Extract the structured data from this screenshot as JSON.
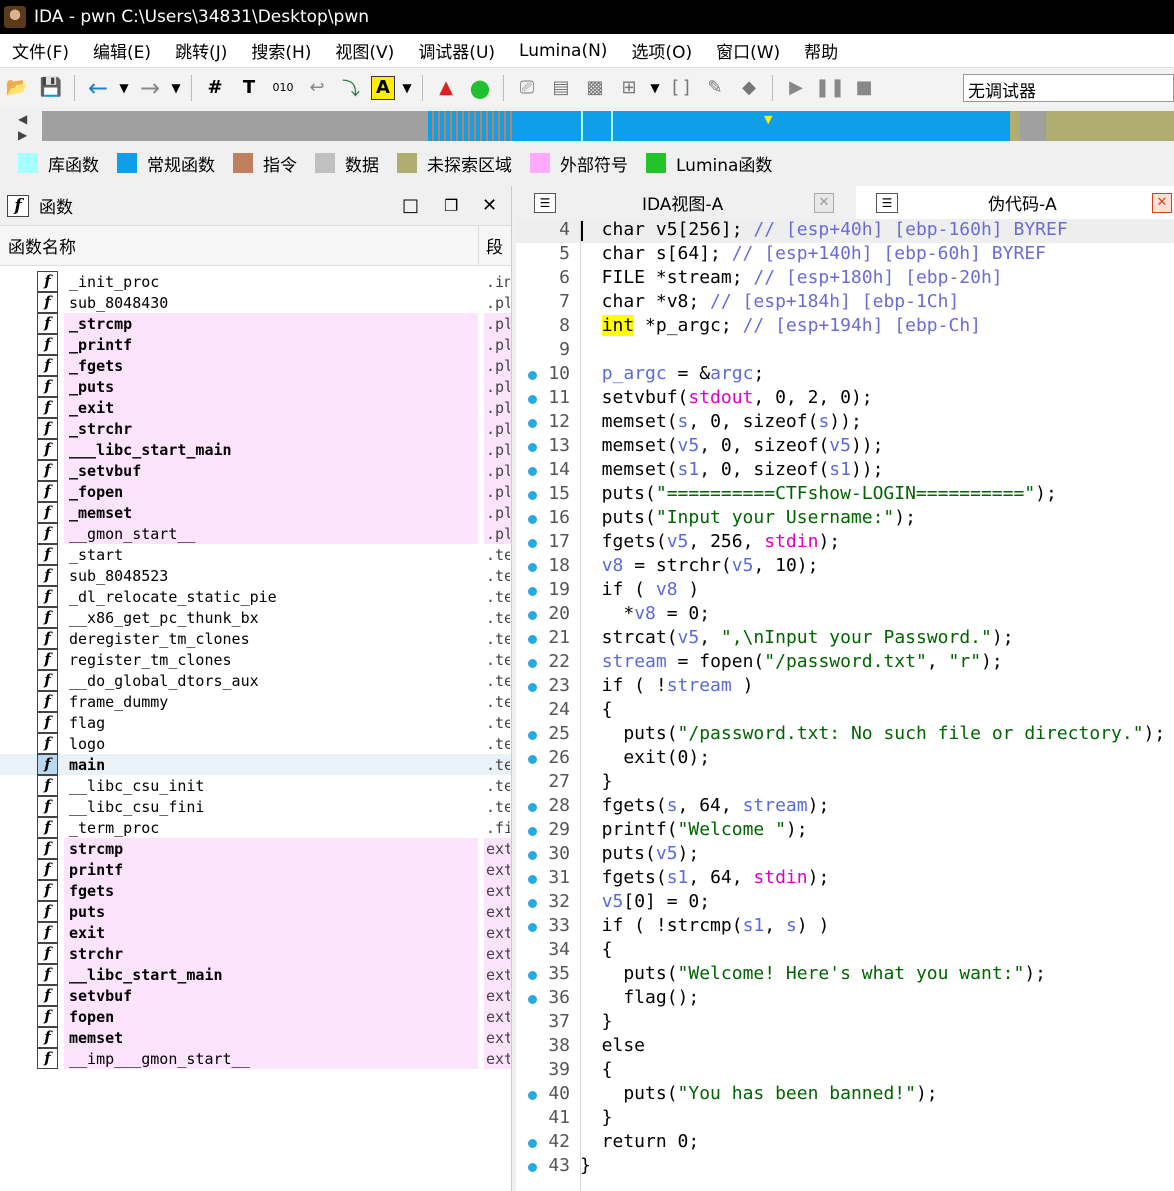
{
  "window": {
    "title": "IDA - pwn C:\\Users\\34831\\Desktop\\pwn"
  },
  "menu": [
    "文件(F)",
    "编辑(E)",
    "跳转(J)",
    "搜索(H)",
    "视图(V)",
    "调试器(U)",
    "Lumina(N)",
    "选项(O)",
    "窗口(W)",
    "帮助"
  ],
  "toolbar": {
    "debugger_label": "无调试器"
  },
  "legend": [
    {
      "label": "库函数",
      "color": "#a8ffff"
    },
    {
      "label": "常规函数",
      "color": "#0f9ee8"
    },
    {
      "label": "指令",
      "color": "#c08060"
    },
    {
      "label": "数据",
      "color": "#c0c0c0"
    },
    {
      "label": "未探索区域",
      "color": "#b0ad70"
    },
    {
      "label": "外部符号",
      "color": "#ffaaff"
    },
    {
      "label": "Lumina函数",
      "color": "#22c42a"
    }
  ],
  "functions_panel": {
    "title": "函数",
    "col_name": "函数名称",
    "col_seg": "段",
    "rows": [
      {
        "name": "_init_proc",
        "seg": ".init",
        "style": "normal"
      },
      {
        "name": "sub_8048430",
        "seg": ".plt",
        "style": "normal"
      },
      {
        "name": "_strcmp",
        "seg": ".plt",
        "style": "pinkbold"
      },
      {
        "name": "_printf",
        "seg": ".plt",
        "style": "pinkbold"
      },
      {
        "name": "_fgets",
        "seg": ".plt",
        "style": "pinkbold"
      },
      {
        "name": "_puts",
        "seg": ".plt",
        "style": "pinkbold"
      },
      {
        "name": "_exit",
        "seg": ".plt",
        "style": "pinkbold"
      },
      {
        "name": "_strchr",
        "seg": ".plt",
        "style": "pinkbold"
      },
      {
        "name": "___libc_start_main",
        "seg": ".plt",
        "style": "pinkbold"
      },
      {
        "name": "_setvbuf",
        "seg": ".plt",
        "style": "pinkbold"
      },
      {
        "name": "_fopen",
        "seg": ".plt",
        "style": "pinkbold"
      },
      {
        "name": "_memset",
        "seg": ".plt",
        "style": "pinkbold"
      },
      {
        "name": "__gmon_start__",
        "seg": ".plt",
        "style": "pink"
      },
      {
        "name": "_start",
        "seg": ".text",
        "style": "normal"
      },
      {
        "name": "sub_8048523",
        "seg": ".text",
        "style": "normal"
      },
      {
        "name": "_dl_relocate_static_pie",
        "seg": ".text",
        "style": "normal"
      },
      {
        "name": "__x86_get_pc_thunk_bx",
        "seg": ".text",
        "style": "normal"
      },
      {
        "name": "deregister_tm_clones",
        "seg": ".text",
        "style": "normal"
      },
      {
        "name": "register_tm_clones",
        "seg": ".text",
        "style": "normal"
      },
      {
        "name": "__do_global_dtors_aux",
        "seg": ".text",
        "style": "normal"
      },
      {
        "name": "frame_dummy",
        "seg": ".text",
        "style": "normal"
      },
      {
        "name": "flag",
        "seg": ".text",
        "style": "normal"
      },
      {
        "name": "logo",
        "seg": ".text",
        "style": "normal"
      },
      {
        "name": "main",
        "seg": ".text",
        "style": "selected"
      },
      {
        "name": "__libc_csu_init",
        "seg": ".text",
        "style": "normal"
      },
      {
        "name": "__libc_csu_fini",
        "seg": ".text",
        "style": "normal"
      },
      {
        "name": "_term_proc",
        "seg": ".fini",
        "style": "normal"
      },
      {
        "name": "strcmp",
        "seg": "extern",
        "style": "pinkbold"
      },
      {
        "name": "printf",
        "seg": "extern",
        "style": "pinkbold"
      },
      {
        "name": "fgets",
        "seg": "extern",
        "style": "pinkbold"
      },
      {
        "name": "puts",
        "seg": "extern",
        "style": "pinkbold"
      },
      {
        "name": "exit",
        "seg": "extern",
        "style": "pinkbold"
      },
      {
        "name": "strchr",
        "seg": "extern",
        "style": "pinkbold"
      },
      {
        "name": "__libc_start_main",
        "seg": "extern",
        "style": "pinkbold"
      },
      {
        "name": "setvbuf",
        "seg": "extern",
        "style": "pinkbold"
      },
      {
        "name": "fopen",
        "seg": "extern",
        "style": "pinkbold"
      },
      {
        "name": "memset",
        "seg": "extern",
        "style": "pinkbold"
      },
      {
        "name": "__imp___gmon_start__",
        "seg": "extern",
        "style": "pink"
      }
    ]
  },
  "tabs": {
    "ida_view": "IDA视图-A",
    "pseudocode": "伪代码-A"
  },
  "code_lines": [
    {
      "n": "4",
      "dot": false,
      "html": "  char v5[256]; <span class=\"cm\">// [esp+40h] [ebp-160h] BYREF</span>"
    },
    {
      "n": "5",
      "dot": false,
      "html": "  char s[64]; <span class=\"cm\">// [esp+140h] [ebp-60h] BYREF</span>"
    },
    {
      "n": "6",
      "dot": false,
      "html": "  FILE *stream; <span class=\"cm\">// [esp+180h] [ebp-20h]</span>"
    },
    {
      "n": "7",
      "dot": false,
      "html": "  char *v8; <span class=\"cm\">// [esp+184h] [ebp-1Ch]</span>"
    },
    {
      "n": "8",
      "dot": false,
      "html": "  <span class=\"kwint\">int</span> *p_argc; <span class=\"cm\">// [esp+194h] [ebp-Ch]</span>"
    },
    {
      "n": "9",
      "dot": false,
      "html": ""
    },
    {
      "n": "10",
      "dot": true,
      "html": "  <span class=\"var\">p_argc</span> = &amp;<span class=\"var\">argc</span>;"
    },
    {
      "n": "11",
      "dot": true,
      "html": "  setvbuf(<span class=\"glob\">stdout</span>, 0, 2, 0);"
    },
    {
      "n": "12",
      "dot": true,
      "html": "  memset(<span class=\"var\">s</span>, 0, sizeof(<span class=\"var\">s</span>));"
    },
    {
      "n": "13",
      "dot": true,
      "html": "  memset(<span class=\"var\">v5</span>, 0, sizeof(<span class=\"var\">v5</span>));"
    },
    {
      "n": "14",
      "dot": true,
      "html": "  memset(<span class=\"var\">s1</span>, 0, sizeof(<span class=\"var\">s1</span>));"
    },
    {
      "n": "15",
      "dot": true,
      "html": "  puts(<span class=\"str\">\"==========CTFshow-LOGIN==========\"</span>);"
    },
    {
      "n": "16",
      "dot": true,
      "html": "  puts(<span class=\"str\">\"Input your Username:\"</span>);"
    },
    {
      "n": "17",
      "dot": true,
      "html": "  fgets(<span class=\"var\">v5</span>, 256, <span class=\"glob\">stdin</span>);"
    },
    {
      "n": "18",
      "dot": true,
      "html": "  <span class=\"var\">v8</span> = strchr(<span class=\"var\">v5</span>, 10);"
    },
    {
      "n": "19",
      "dot": true,
      "html": "  if ( <span class=\"var\">v8</span> )"
    },
    {
      "n": "20",
      "dot": true,
      "html": "    *<span class=\"var\">v8</span> = 0;"
    },
    {
      "n": "21",
      "dot": true,
      "html": "  strcat(<span class=\"var\">v5</span>, <span class=\"str\">\",\\nInput your Password.\"</span>);"
    },
    {
      "n": "22",
      "dot": true,
      "html": "  <span class=\"var\">stream</span> = fopen(<span class=\"str\">\"/password.txt\"</span>, <span class=\"str\">\"r\"</span>);"
    },
    {
      "n": "23",
      "dot": true,
      "html": "  if ( !<span class=\"var\">stream</span> )"
    },
    {
      "n": "24",
      "dot": false,
      "html": "  {"
    },
    {
      "n": "25",
      "dot": true,
      "html": "    puts(<span class=\"str\">\"/password.txt: No such file or directory.\"</span>);"
    },
    {
      "n": "26",
      "dot": true,
      "html": "    exit(0);"
    },
    {
      "n": "27",
      "dot": false,
      "html": "  }"
    },
    {
      "n": "28",
      "dot": true,
      "html": "  fgets(<span class=\"var\">s</span>, 64, <span class=\"var\">stream</span>);"
    },
    {
      "n": "29",
      "dot": true,
      "html": "  printf(<span class=\"str\">\"Welcome \"</span>);"
    },
    {
      "n": "30",
      "dot": true,
      "html": "  puts(<span class=\"var\">v5</span>);"
    },
    {
      "n": "31",
      "dot": true,
      "html": "  fgets(<span class=\"var\">s1</span>, 64, <span class=\"glob\">stdin</span>);"
    },
    {
      "n": "32",
      "dot": true,
      "html": "  <span class=\"var\">v5</span>[0] = 0;"
    },
    {
      "n": "33",
      "dot": true,
      "html": "  if ( !strcmp(<span class=\"var\">s1</span>, <span class=\"var\">s</span>) )"
    },
    {
      "n": "34",
      "dot": false,
      "html": "  {"
    },
    {
      "n": "35",
      "dot": true,
      "html": "    puts(<span class=\"str\">\"Welcome! Here's what you want:\"</span>);"
    },
    {
      "n": "36",
      "dot": true,
      "html": "    flag();"
    },
    {
      "n": "37",
      "dot": false,
      "html": "  }"
    },
    {
      "n": "38",
      "dot": false,
      "html": "  else"
    },
    {
      "n": "39",
      "dot": false,
      "html": "  {"
    },
    {
      "n": "40",
      "dot": true,
      "html": "    puts(<span class=\"str\">\"You has been banned!\"</span>);"
    },
    {
      "n": "41",
      "dot": false,
      "html": "  }"
    },
    {
      "n": "42",
      "dot": true,
      "html": "  return 0;"
    },
    {
      "n": "43",
      "dot": true,
      "html": "}"
    }
  ]
}
